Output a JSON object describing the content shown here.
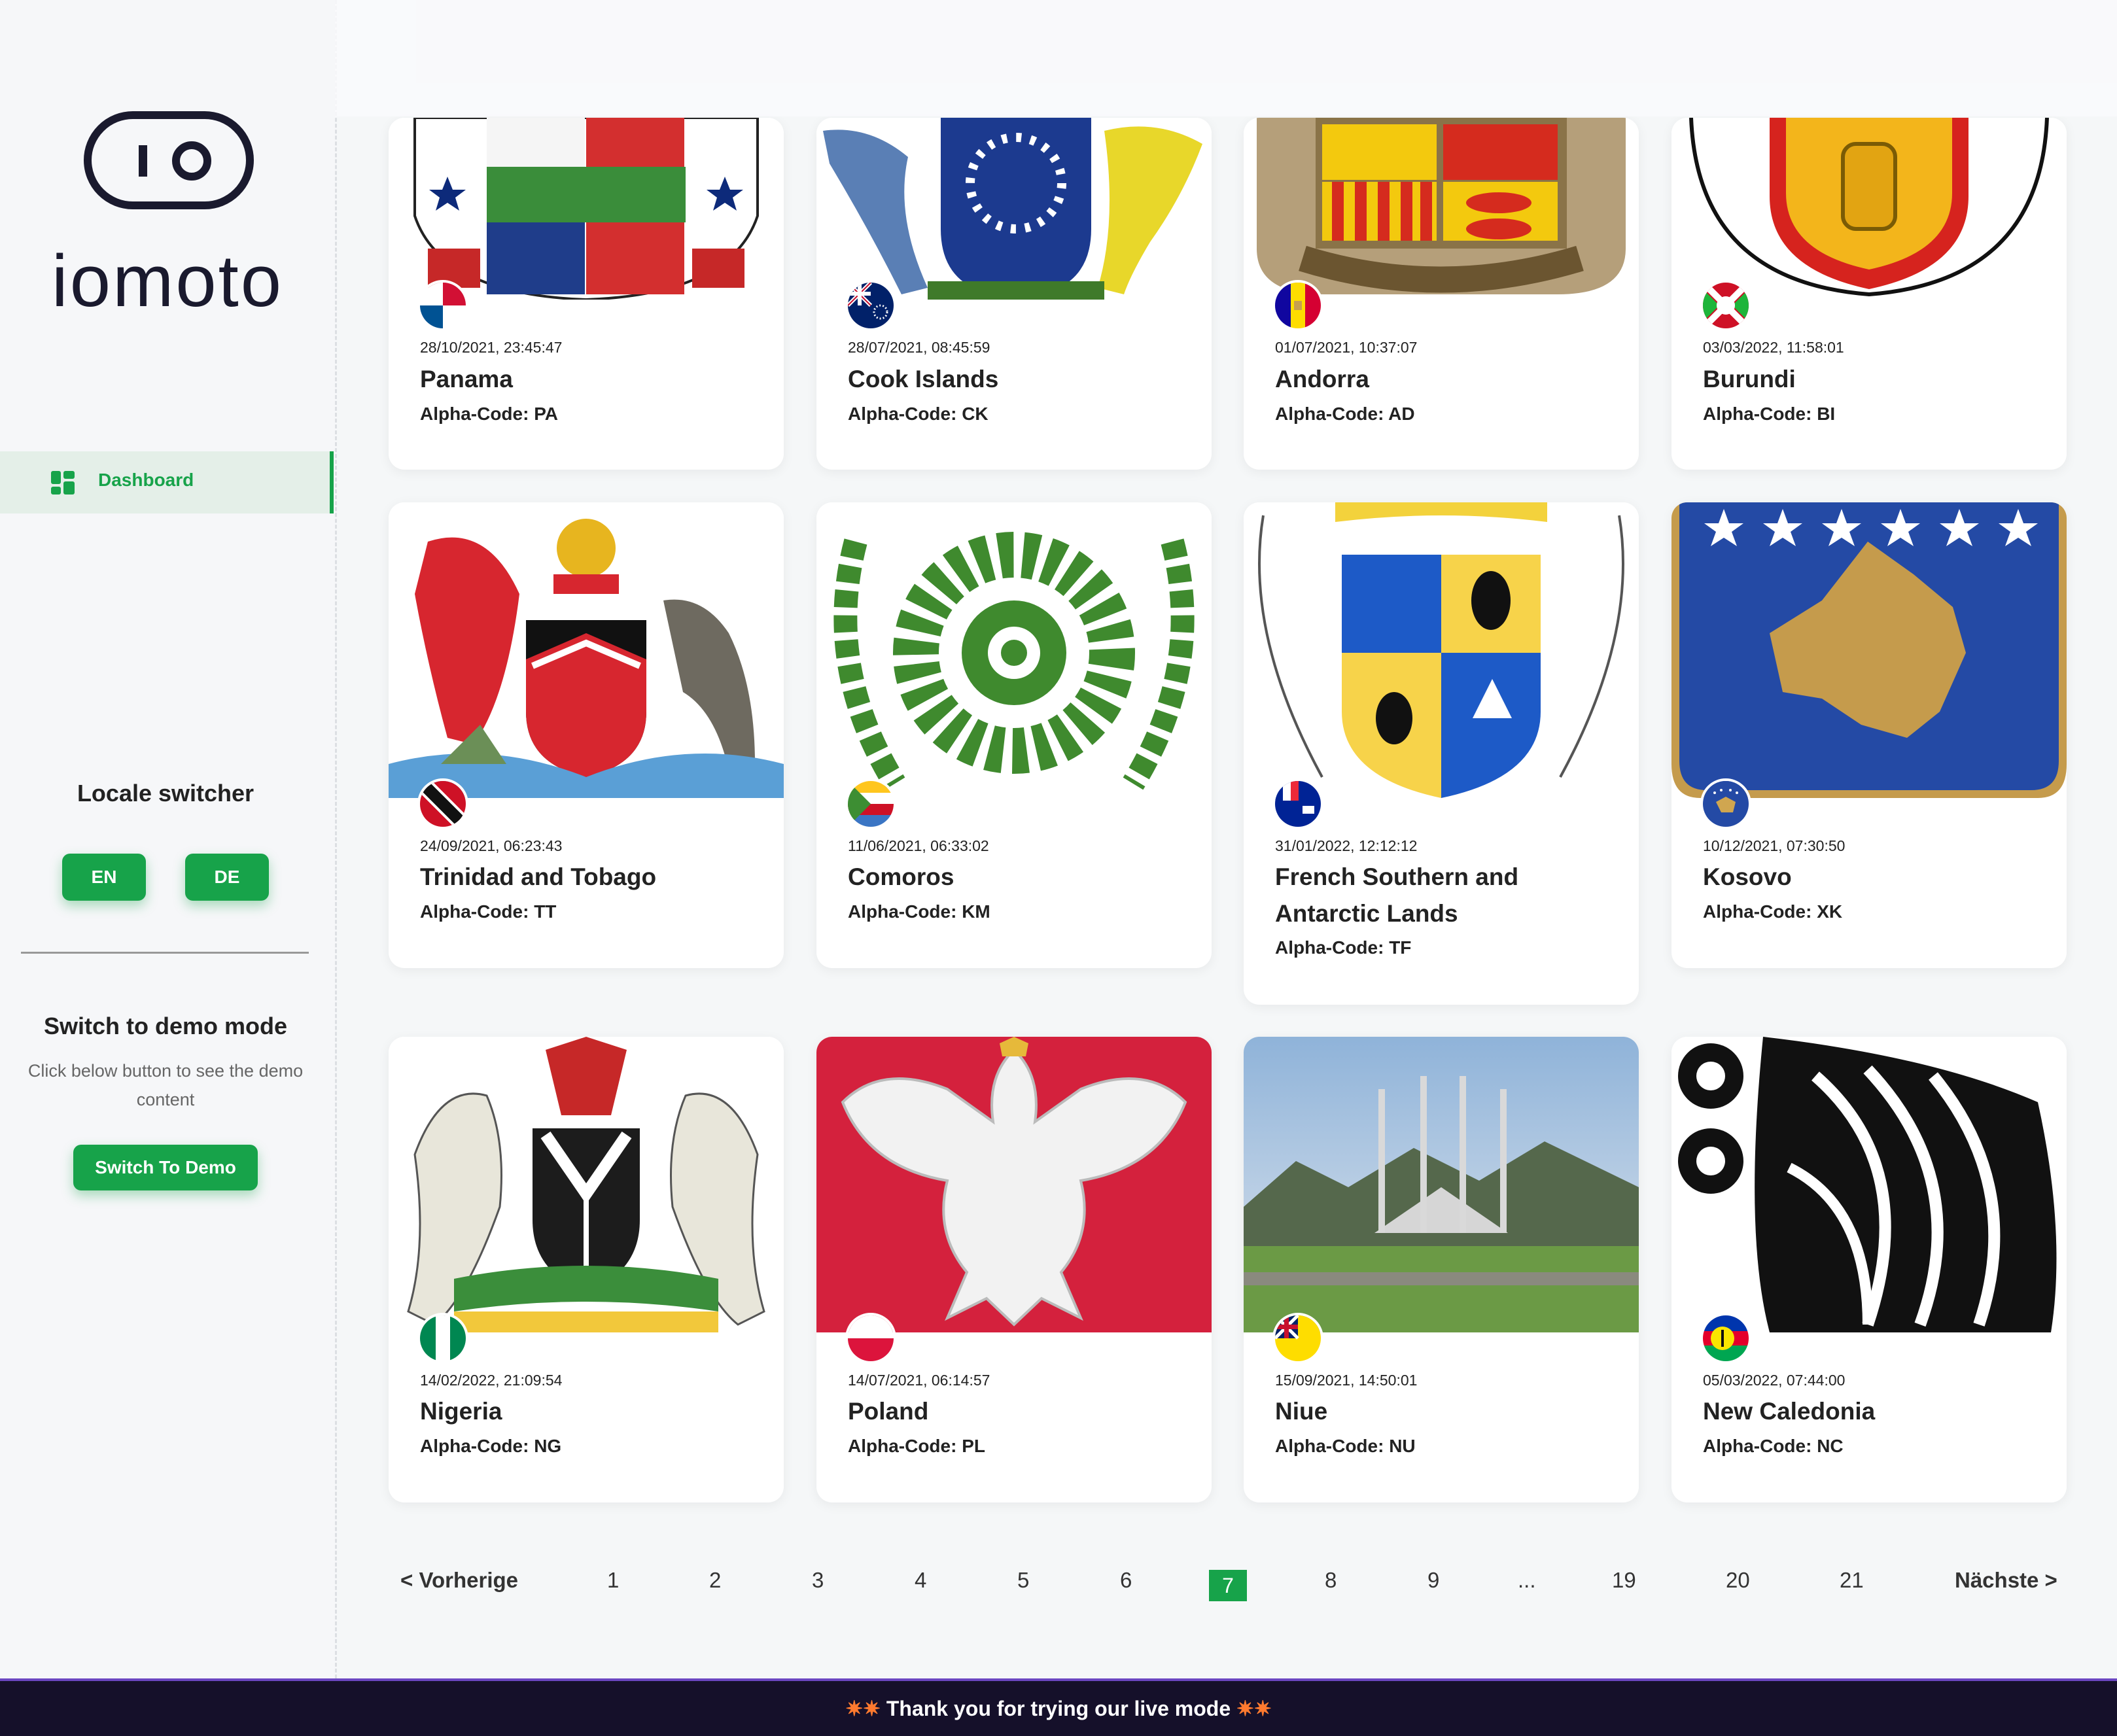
{
  "brand": {
    "name": "iomoto"
  },
  "sidebar": {
    "nav": [
      {
        "label": "Dashboard",
        "icon": "dashboard-icon"
      }
    ],
    "locale": {
      "title": "Locale switcher",
      "options": [
        "EN",
        "DE"
      ]
    },
    "demo": {
      "title": "Switch to demo mode",
      "description": "Click below button to see the demo content",
      "button": "Switch To Demo"
    }
  },
  "accent_color": "#17a34a",
  "cards": [
    {
      "date": "28/10/2021, 23:45:47",
      "name": "Panama",
      "code": "Alpha-Code: PA"
    },
    {
      "date": "28/07/2021, 08:45:59",
      "name": "Cook Islands",
      "code": "Alpha-Code: CK"
    },
    {
      "date": "01/07/2021, 10:37:07",
      "name": "Andorra",
      "code": "Alpha-Code: AD"
    },
    {
      "date": "03/03/2022, 11:58:01",
      "name": "Burundi",
      "code": "Alpha-Code: BI"
    },
    {
      "date": "24/09/2021, 06:23:43",
      "name": "Trinidad and Tobago",
      "code": "Alpha-Code: TT"
    },
    {
      "date": "11/06/2021, 06:33:02",
      "name": "Comoros",
      "code": "Alpha-Code: KM"
    },
    {
      "date": "31/01/2022, 12:12:12",
      "name": "French Southern and Antarctic Lands",
      "code": "Alpha-Code: TF"
    },
    {
      "date": "10/12/2021, 07:30:50",
      "name": "Kosovo",
      "code": "Alpha-Code: XK"
    },
    {
      "date": "14/02/2022, 21:09:54",
      "name": "Nigeria",
      "code": "Alpha-Code: NG"
    },
    {
      "date": "14/07/2021, 06:14:57",
      "name": "Poland",
      "code": "Alpha-Code: PL"
    },
    {
      "date": "15/09/2021, 14:50:01",
      "name": "Niue",
      "code": "Alpha-Code: NU"
    },
    {
      "date": "05/03/2022, 07:44:00",
      "name": "New Caledonia",
      "code": "Alpha-Code: NC"
    }
  ],
  "pagination": {
    "prev": "< Vorherige",
    "next": "Nächste >",
    "pages": [
      "1",
      "2",
      "3",
      "4",
      "5",
      "6",
      "7",
      "8",
      "9",
      "...",
      "19",
      "20",
      "21"
    ],
    "current": "7"
  },
  "footer": {
    "text": "Thank you for trying our live mode",
    "icon": "sparkle-icon"
  }
}
